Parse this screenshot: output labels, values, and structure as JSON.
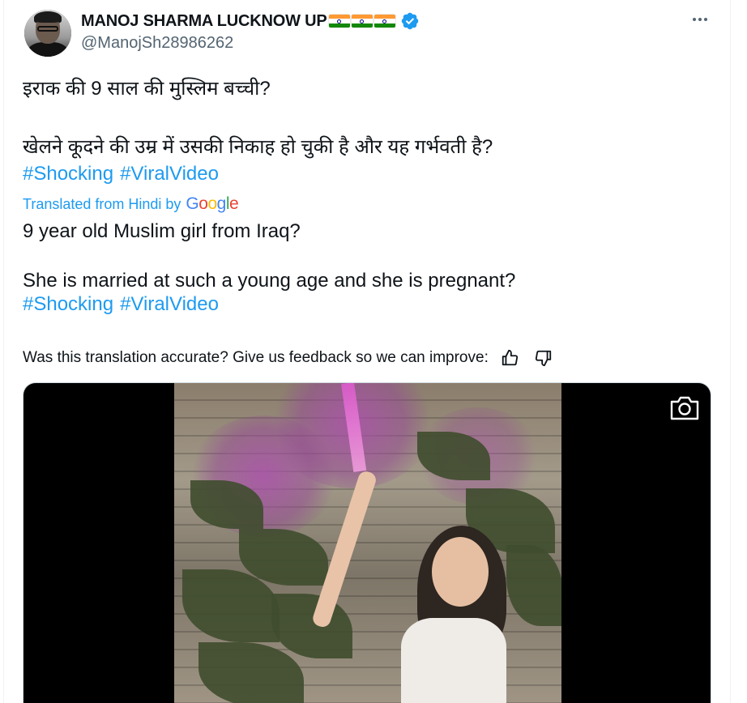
{
  "author": {
    "display_name": "MANOJ SHARMA LUCKNOW UP",
    "handle": "@ManojSh28986262",
    "flags": [
      "india-flag",
      "india-flag",
      "india-flag"
    ],
    "verified": true
  },
  "tweet": {
    "original_line1": "इराक की 9 साल की मुस्लिम बच्ची?",
    "original_line2": "खेलने कूदने की उम्र में उसकी निकाह हो चुकी है और यह गर्भवती है?",
    "hashtags": [
      "#Shocking",
      "#ViralVideo"
    ],
    "translated_label": "Translated from Hindi by",
    "translation_provider": "Google",
    "translated_line1": "9 year old Muslim girl from Iraq?",
    "translated_line2": "She is married at such a young age and she is pregnant?",
    "feedback_prompt": "Was this translation accurate? Give us feedback so we can improve:"
  },
  "icons": {
    "more": "more-options-icon",
    "verified": "verified-badge-icon",
    "thumbs_up": "thumbs-up-icon",
    "thumbs_down": "thumbs-down-icon",
    "camera": "camera-icon"
  },
  "colors": {
    "accent": "#1d9bf0",
    "text_primary": "#0f1419",
    "text_secondary": "#536471"
  }
}
